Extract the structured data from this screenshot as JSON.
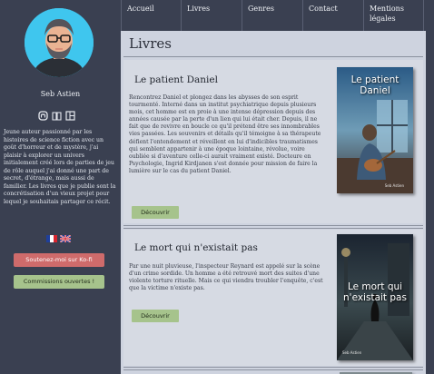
{
  "nav": {
    "items": [
      "Accueil",
      "Livres",
      "Genres",
      "Contact",
      "Mentions légales"
    ]
  },
  "sidebar": {
    "author_name": "Seb Astien",
    "bio": "Jeune auteur passionné par les histoires de science fiction avec un goût d'horreur et de mystère, j'ai plaisir à explorer un univers initialement créé lors de parties de jeu de rôle auquel j'ai donné une part de secret, d'étrange, mais aussi de familier. Les livres que je publie sont la concrétisation d'un vieux projet pour lequel je souhaitais partager ce récit.",
    "social_icons": [
      "mastodon-icon",
      "book-icon",
      "layout-icon"
    ],
    "flags": [
      "flag-fr",
      "flag-uk"
    ],
    "kofi_label": "Soutenez-moi sur Ko-fi",
    "commissions_label": "Commissions ouvertes !"
  },
  "main": {
    "title": "Livres",
    "books": [
      {
        "title": "Le patient Daniel",
        "description": "Rencontrez Daniel et plongez dans les abysses de son esprit tourmenté. Interné dans un institut psychiatrique depuis plusieurs mois, cet homme est en proie à une intense dépression depuis des années causée par la perte d'un lien qui lui était cher. Depuis, il ne fait que de revivre en boucle ce qu'il prétend être ses innombrables vies passées. Les souvenirs et détails qu'il témoigne à sa thérapeute défient l'entendement et réveillent en lui d'indicibles traumatismes qui semblent appartenir à une époque lointaine, révolue, voire oubliée si d'aventure celle-ci aurait vraiment existé. Docteure en Psychologie, Ingrid Kirdjanen s'est donnée pour mission de faire la lumière sur le cas du patient Daniel.",
        "button": "Découvrir",
        "cover_title": "Le patient Daniel",
        "cover_author": "Seb Astien"
      },
      {
        "title": "Le mort qui n'existait pas",
        "description": "Par une nuit pluvieuse, l'inspecteur Reynard est appelé sur la scène d'un crime sordide. Un homme a été retrouvé mort des suites d'une violente torture rituelle. Mais ce qui viendra troubler l'enquête, c'est que la victime n'existe pas.",
        "button": "Découvrir",
        "cover_title": "Le mort qui n'existait pas",
        "cover_author": "Seb Astien"
      }
    ]
  },
  "colors": {
    "sidebar_bg": "#3a4051",
    "main_bg": "#ced3df",
    "kofi": "#cf6b6b",
    "green_button": "#a6c38c",
    "avatar_bg": "#3fc6ee"
  }
}
